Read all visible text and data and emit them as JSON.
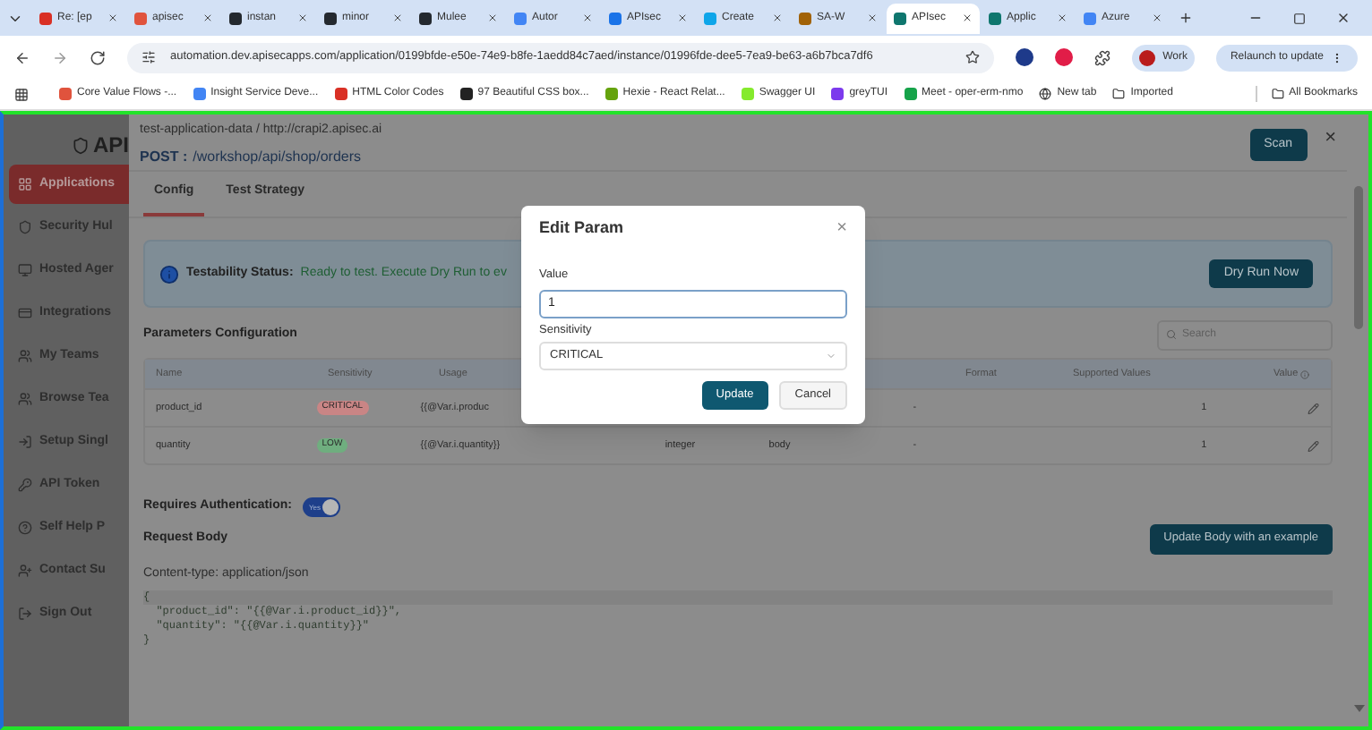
{
  "browser": {
    "tabs": [
      {
        "title": "Re: [ep",
        "selected": false
      },
      {
        "title": "apisec",
        "selected": false
      },
      {
        "title": "instan",
        "selected": false
      },
      {
        "title": "minor",
        "selected": false
      },
      {
        "title": "Mulee",
        "selected": false
      },
      {
        "title": "Autor",
        "selected": false
      },
      {
        "title": "APIsec",
        "selected": false
      },
      {
        "title": "Create",
        "selected": false
      },
      {
        "title": "SA-W",
        "selected": false
      },
      {
        "title": "APIsec",
        "selected": true
      },
      {
        "title": "Applic",
        "selected": false
      },
      {
        "title": "Azure",
        "selected": false
      }
    ],
    "address": "automation.dev.apisecapps.com/application/0199bfde-e50e-74e9-b8fe-1aedd84c7aed/instance/01996fde-dee5-7ea9-be63-a6b7bca7df6",
    "profile": "Work",
    "relaunch": "Relaunch to update",
    "bookmarks": [
      {
        "label": "Core Value Flows -..."
      },
      {
        "label": "Insight Service Deve..."
      },
      {
        "label": "HTML Color Codes"
      },
      {
        "label": "97 Beautiful CSS box..."
      },
      {
        "label": "Hexie - React Relat..."
      },
      {
        "label": "Swagger UI"
      },
      {
        "label": "greyTUI"
      },
      {
        "label": "Meet - oper-erm-nmo"
      },
      {
        "label": "New tab"
      },
      {
        "label": "Imported"
      }
    ],
    "all_bookmarks": "All Bookmarks"
  },
  "sidebar": {
    "logo": "API",
    "items": [
      {
        "label": "Applications",
        "selected": true
      },
      {
        "label": "Security Hul",
        "selected": false
      },
      {
        "label": "Hosted Ager",
        "selected": false
      },
      {
        "label": "Integrations",
        "selected": false
      },
      {
        "label": "My Teams",
        "selected": false
      },
      {
        "label": "Browse Tea",
        "selected": false
      },
      {
        "label": "Setup Singl",
        "selected": false
      },
      {
        "label": "API Token",
        "selected": false
      },
      {
        "label": "Self Help P",
        "selected": false
      },
      {
        "label": "Contact Su",
        "selected": false
      },
      {
        "label": "Sign Out",
        "selected": false
      }
    ]
  },
  "drawer": {
    "breadcrumb": "test-application-data / http://crapi2.apisec.ai",
    "method": "POST :",
    "path": "/workshop/api/shop/orders",
    "scan_button": "Scan",
    "close": "×",
    "tabs": [
      {
        "label": "Config",
        "selected": true
      },
      {
        "label": "Test Strategy",
        "selected": false
      }
    ],
    "testability": {
      "label": "Testability Status:",
      "message": "Ready to test. Execute Dry Run to ev",
      "button": "Dry Run Now"
    },
    "parameters": {
      "title": "Parameters Configuration",
      "search_placeholder": "Search",
      "columns": [
        "Name",
        "Sensitivity",
        "Usage",
        "Format",
        "Supported Values",
        "Value"
      ],
      "rows": [
        {
          "name": "product_id",
          "sensitivity": "CRITICAL",
          "color": "#c98585",
          "usage": "{{@Var.i.produc",
          "format": "-",
          "value": "1"
        },
        {
          "name": "quantity",
          "sensitivity": "LOW",
          "color": "#6fae7f",
          "usage": "{{@Var.i.quantity}}",
          "type": "integer",
          "location": "body",
          "format": "-",
          "value": "1"
        }
      ]
    },
    "auth": {
      "label": "Requires Authentication:",
      "toggle_text": "Yes",
      "on": true
    },
    "request_body": {
      "title": "Request Body",
      "button": "Update Body with an example",
      "content_type": "Content-type: application/json",
      "code": [
        "{",
        "  \"product_id\": \"{{@Var.i.product_id}}\",",
        "  \"quantity\": \"{{@Var.i.quantity}}\"",
        "}"
      ]
    }
  },
  "modal": {
    "title": "Edit Param",
    "close": "×",
    "value_label": "Value",
    "value": "1",
    "sensitivity_label": "Sensitivity",
    "sensitivity": "CRITICAL",
    "update": "Update",
    "cancel": "Cancel"
  }
}
